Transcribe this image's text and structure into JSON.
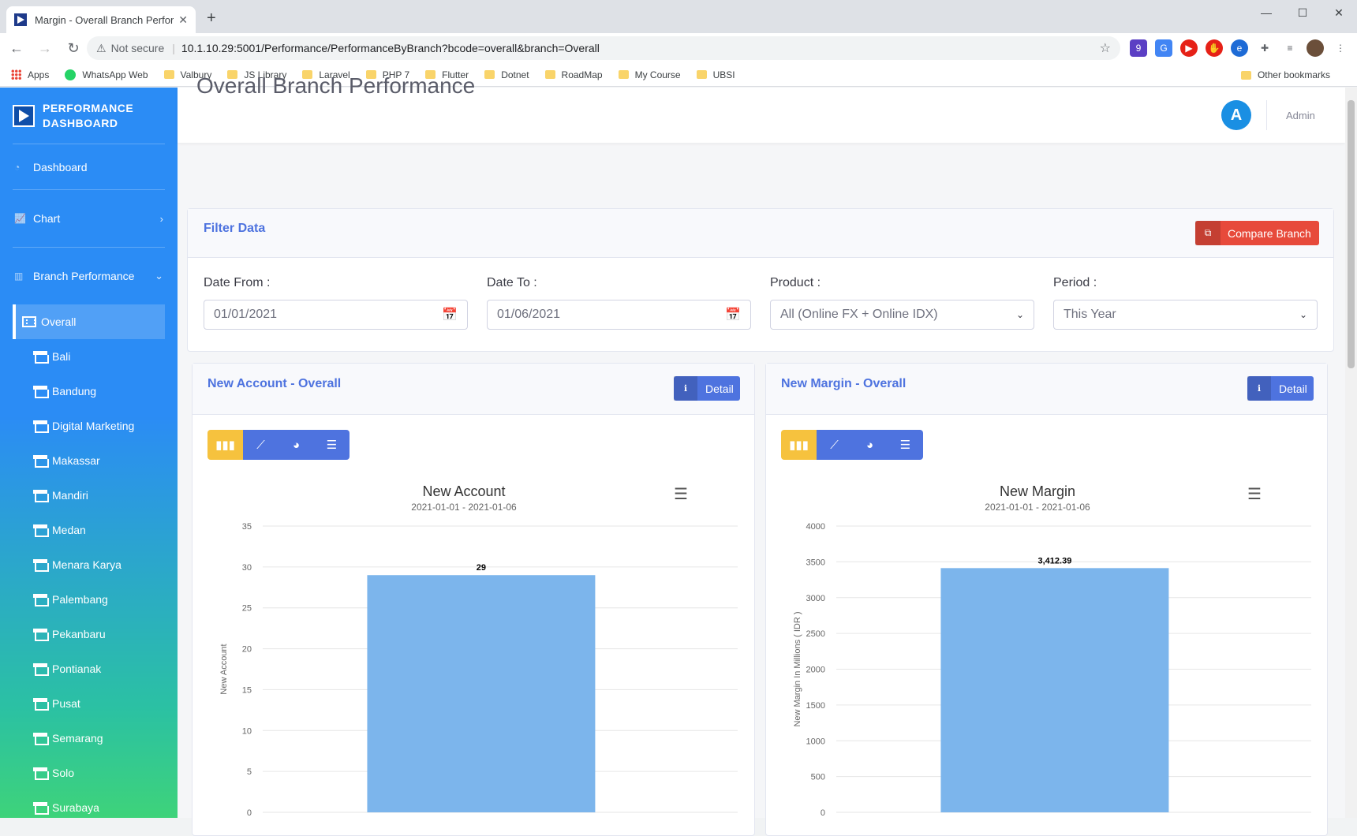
{
  "browser": {
    "tab_title": "Margin - Overall Branch Performance",
    "new_tab": "+",
    "not_secure": "Not secure",
    "url": "10.1.10.29:5001/Performance/PerformanceByBranch?bcode=overall&branch=Overall",
    "bookmarks": [
      "Apps",
      "WhatsApp Web",
      "Valbury",
      "JS Library",
      "Laravel",
      "PHP 7",
      "Flutter",
      "Dotnet",
      "RoadMap",
      "My Course",
      "UBSI"
    ],
    "other_bookmarks": "Other bookmarks",
    "ext_badge": "9"
  },
  "sidebar": {
    "brand": "PERFORMANCE DASHBOARD",
    "dashboard": "Dashboard",
    "chart": "Chart",
    "branch_performance": "Branch Performance",
    "active_sub": "Overall",
    "branches": [
      "Bali",
      "Bandung",
      "Digital Marketing",
      "Makassar",
      "Mandiri",
      "Medan",
      "Menara Karya",
      "Palembang",
      "Pekanbaru",
      "Pontianak",
      "Pusat",
      "Semarang",
      "Solo",
      "Surabaya"
    ]
  },
  "topbar": {
    "avatar_letter": "A",
    "user": "Admin"
  },
  "page": {
    "title": "Overall Branch Performance"
  },
  "filter": {
    "title": "Filter Data",
    "compare_button": "Compare Branch",
    "date_from_label": "Date From :",
    "date_from_value": "01/01/2021",
    "date_to_label": "Date To :",
    "date_to_value": "01/06/2021",
    "product_label": "Product :",
    "product_value": "All (Online FX + Online IDX)",
    "period_label": "Period :",
    "period_value": "This Year"
  },
  "cards": {
    "account_title": "New Account - Overall",
    "margin_title": "New Margin - Overall",
    "detail_label": "Detail"
  },
  "chart_data": [
    {
      "type": "bar",
      "title": "New Account",
      "subtitle": "2021-01-01 - 2021-01-06",
      "ylabel": "New Account",
      "ylim": [
        0,
        35
      ],
      "yticks": [
        0,
        5,
        10,
        15,
        20,
        25,
        30,
        35
      ],
      "values": [
        29
      ],
      "data_labels": [
        "29"
      ],
      "color": "#7cb5ec",
      "grid": true
    },
    {
      "type": "bar",
      "title": "New Margin",
      "subtitle": "2021-01-01 - 2021-01-06",
      "ylabel": "New Margin In Millions ( IDR )",
      "ylim": [
        0,
        4000
      ],
      "yticks": [
        0,
        500,
        1000,
        1500,
        2000,
        2500,
        3000,
        3500,
        4000
      ],
      "values": [
        3412.39
      ],
      "data_labels": [
        "3,412.39"
      ],
      "color": "#7cb5ec",
      "grid": true
    }
  ]
}
